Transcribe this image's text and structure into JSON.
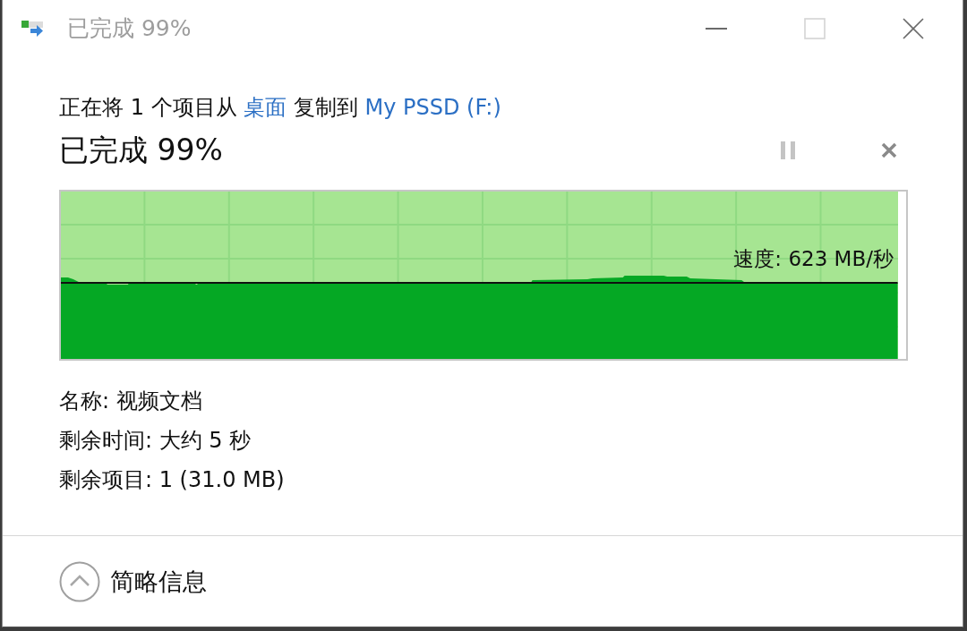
{
  "window": {
    "title": "已完成 99%",
    "controls": [
      {
        "kind": "minimize",
        "disabled": false
      },
      {
        "kind": "maximize",
        "disabled": true
      },
      {
        "kind": "close",
        "disabled": false
      }
    ]
  },
  "copy_line": [
    {
      "kind": "plain",
      "text": "正在将 1 个项目从"
    },
    {
      "kind": "link",
      "text": "桌面"
    },
    {
      "kind": "plain",
      "text": "复制到"
    },
    {
      "kind": "link",
      "text": "My PSSD (F:)"
    }
  ],
  "progress": {
    "heading": "已完成 99%",
    "level": 0.99,
    "speed": "速度: 623 MB/秒"
  },
  "details": [
    "名称: 视频文档",
    "剩余时间: 大约 5 秒",
    "剩余项目: 1 (31.0 MB)"
  ],
  "footer": {
    "toggle": "简略信息",
    "expanded": true
  }
}
